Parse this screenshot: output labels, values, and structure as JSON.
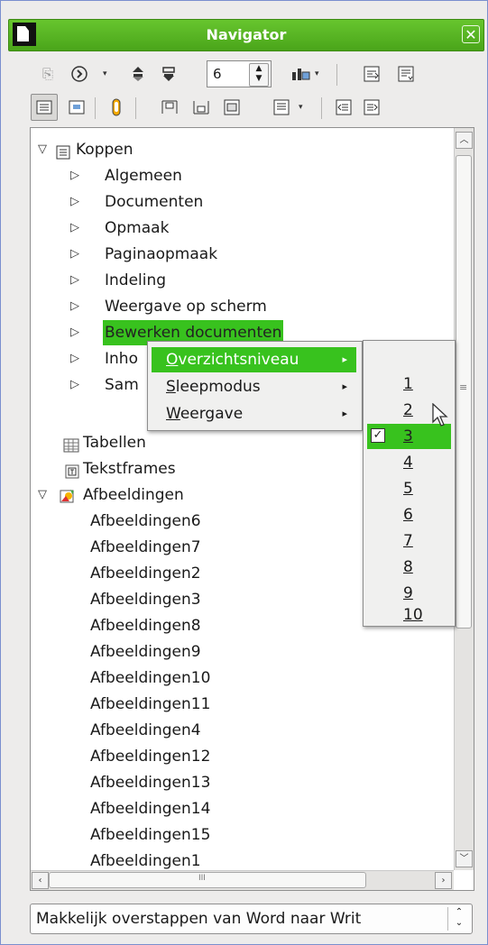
{
  "window": {
    "title": "Navigator",
    "close": "✕"
  },
  "toolbar1": {
    "spin_value": "6",
    "spin_up": "▲",
    "spin_down": "▼",
    "dropdown": "▾"
  },
  "tree": {
    "root_headings": "Koppen",
    "headings": [
      "Algemeen",
      "Documenten",
      "Opmaak",
      "Paginaopmaak",
      "Indeling",
      "Weergave op scherm",
      "Bewerken documenten",
      "Inho",
      "Sam"
    ],
    "tables": "Tabellen",
    "textframes": "Tekstframes",
    "images": "Afbeeldingen",
    "image_items": [
      "Afbeeldingen6",
      "Afbeeldingen7",
      "Afbeeldingen2",
      "Afbeeldingen3",
      "Afbeeldingen8",
      "Afbeeldingen9",
      "Afbeeldingen10",
      "Afbeeldingen11",
      "Afbeeldingen4",
      "Afbeeldingen12",
      "Afbeeldingen13",
      "Afbeeldingen14",
      "Afbeeldingen15",
      "Afbeeldingen1"
    ],
    "hscroll_mark": "III",
    "vscroll_mark": "≡"
  },
  "context_menu": {
    "items": [
      {
        "mnemonic": "O",
        "rest": "verzichtsniveau"
      },
      {
        "mnemonic": "S",
        "rest": "leepmodus"
      },
      {
        "mnemonic": "W",
        "rest": "eergave"
      }
    ],
    "arrow": "▸"
  },
  "submenu": {
    "levels": [
      "1",
      "2",
      "3",
      "4",
      "5",
      "6",
      "7",
      "8",
      "9",
      "10"
    ],
    "checked": "3",
    "check": "✓"
  },
  "document_selector": {
    "value": "Makkelijk overstappen van Word naar Writ",
    "arrow": "⌃⌄"
  }
}
